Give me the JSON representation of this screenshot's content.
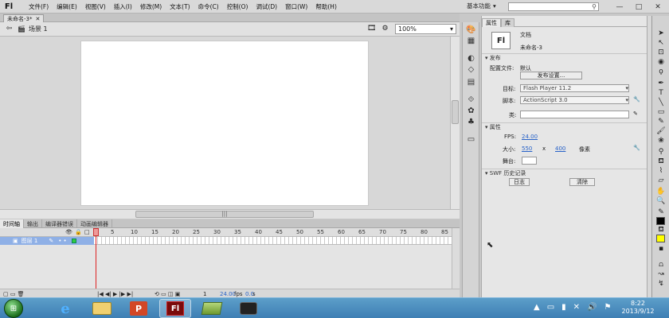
{
  "app": {
    "logo": "Fl",
    "menu": [
      "文件(F)",
      "编辑(E)",
      "视图(V)",
      "插入(I)",
      "修改(M)",
      "文本(T)",
      "命令(C)",
      "控制(O)",
      "调试(D)",
      "窗口(W)",
      "帮助(H)"
    ],
    "workspace_label": "基本功能",
    "workspace_arrow": "▾",
    "search_icon": "⚲",
    "window_controls": [
      "—",
      "□",
      "✕"
    ]
  },
  "document": {
    "tab_label": "未命名-3*",
    "tab_close": "✕",
    "scene_label": "场景 1",
    "zoom": "100%",
    "zoom_arrow": "▾",
    "h_thumb_grip": "|||"
  },
  "timeline": {
    "tabs": [
      "时间轴",
      "输出",
      "编译器错误",
      "动画编辑器"
    ],
    "header_icons": [
      "👁",
      "🔒",
      "□"
    ],
    "ruler_numbers": [
      "5",
      "10",
      "15",
      "20",
      "25",
      "30",
      "35",
      "40",
      "45",
      "50",
      "55",
      "60",
      "65",
      "70",
      "75",
      "80",
      "85"
    ],
    "layer_name": "图层 1",
    "layer_dots": "•  •",
    "fps": "24.00",
    "fps_unit": "fps",
    "time": "0.0",
    "time_unit": "s",
    "current_frame": "1",
    "bottom_controls": "|◀  ◀|  ▶  |▶  ▶|",
    "layer_buttons": "▢  ▭  🗑"
  },
  "dock_icons": [
    "palette-icon",
    "grid-icon",
    "info-icon",
    "transform-icon",
    "code-icon",
    "components-icon",
    "library-icon",
    "motion-icon"
  ],
  "properties": {
    "tabs": [
      "属性",
      "库"
    ],
    "doc_icon": "Fl",
    "doc_type": "文档",
    "doc_name": "未命名-3",
    "section_publish": "发布",
    "profile_label": "配置文件:",
    "profile_value": "默认",
    "publish_settings_btn": "发布设置...",
    "target_label": "目标:",
    "target_value": "Flash Player 11.2",
    "script_label": "脚本:",
    "script_value": "ActionScript 3.0",
    "class_label": "类:",
    "section_props": "属性",
    "fps_label": "FPS:",
    "fps_value": "24.00",
    "size_label": "大小:",
    "width": "550",
    "times": "x",
    "height": "400",
    "unit": "像素",
    "stage_label": "舞台:",
    "section_swf": "SWF 历史记录",
    "log_btn": "日志",
    "clear_btn": "清除",
    "select_arrow": "▾",
    "wrench": "🔧",
    "pencil": "✎"
  },
  "colors": {
    "stroke_swatch": "#000000",
    "fill_swatch": "#ffff00",
    "layer_highlight": "#8fb0e6",
    "playhead": "#dd2222"
  },
  "taskbar": {
    "start_glyph": "⊞",
    "apps": [
      "ie-icon",
      "explorer-icon",
      "powerpoint-icon",
      "flash-icon",
      "folder-icon",
      "camera-icon"
    ],
    "ie_glyph": "e",
    "ppt_glyph": "P",
    "fl_glyph": "Fl",
    "tray_icons": [
      "▲",
      "▭",
      "▮",
      "✕",
      "🔊",
      "⚑"
    ],
    "time": "8:22",
    "date": "2013/9/12"
  }
}
